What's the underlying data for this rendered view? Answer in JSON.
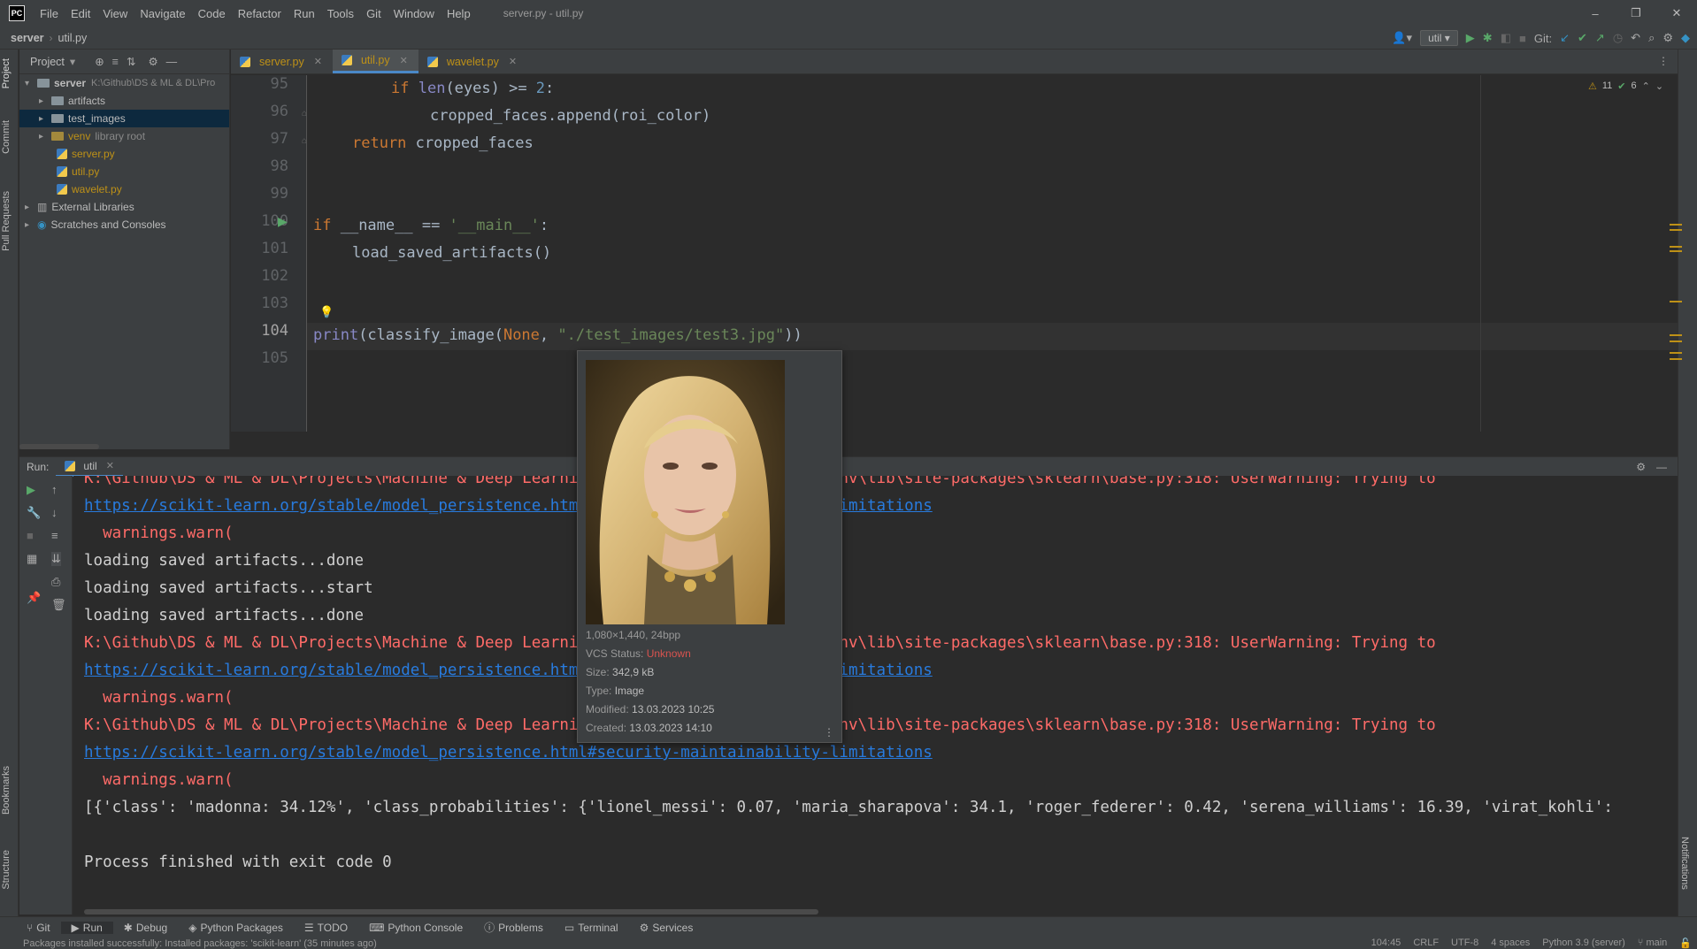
{
  "app": {
    "logo": "PC",
    "window_title": "server.py - util.py"
  },
  "menu": [
    "File",
    "Edit",
    "View",
    "Navigate",
    "Code",
    "Refactor",
    "Run",
    "Tools",
    "Git",
    "Window",
    "Help"
  ],
  "window_controls": {
    "minimize": "–",
    "restore": "❐",
    "close": "✕"
  },
  "breadcrumb": {
    "project": "server",
    "file": "util.py"
  },
  "toolbar": {
    "run_config": "util",
    "git_label": "Git:"
  },
  "left_strip": {
    "project": "Project",
    "commit": "Commit",
    "pull_requests": "Pull Requests",
    "bookmarks": "Bookmarks",
    "structure": "Structure"
  },
  "right_strip": {
    "notifications": "Notifications"
  },
  "project_panel": {
    "title": "Project",
    "root_name": "server",
    "root_path": "K:\\Github\\DS & ML & DL\\Pro",
    "items": [
      {
        "label": "artifacts",
        "kind": "folder"
      },
      {
        "label": "test_images",
        "kind": "folder"
      },
      {
        "label": "venv",
        "extra": "library root",
        "kind": "folder"
      },
      {
        "label": "server.py",
        "kind": "py"
      },
      {
        "label": "util.py",
        "kind": "py"
      },
      {
        "label": "wavelet.py",
        "kind": "py"
      }
    ],
    "external": "External Libraries",
    "scratches": "Scratches and Consoles"
  },
  "editor_tabs": [
    {
      "label": "server.py"
    },
    {
      "label": "util.py",
      "active": true
    },
    {
      "label": "wavelet.py"
    }
  ],
  "inspections": {
    "warnings": "11",
    "ok": "6"
  },
  "line_numbers": [
    "95",
    "96",
    "97",
    "98",
    "99",
    "100",
    "101",
    "102",
    "103",
    "104",
    "105"
  ],
  "code": {
    "l95_kw": "if ",
    "l95_bi": "len",
    "l95_mid": "(eyes) >= ",
    "l95_num": "2",
    "l95_end": ":",
    "l96": "cropped_faces.append(roi_color)",
    "l97_kw": "return ",
    "l97_rest": "cropped_faces",
    "l100_kw": "if ",
    "l100_mid": "__name__ == ",
    "l100_str": "'__main__'",
    "l100_end": ":",
    "l101": "load_saved_artifacts()",
    "l104_bi": "print",
    "l104_a": "(classify_image(",
    "l104_kw": "None",
    "l104_b": ", ",
    "l104_str": "\"./test_images/test3.jpg\"",
    "l104_c": "))"
  },
  "run": {
    "label": "Run:",
    "tab": "util"
  },
  "console": [
    {
      "cls": "err",
      "text": "K:\\Github\\DS & ML & DL\\Projects\\Machine & Deep Learning\\FaceRecognition\\server\\venv\\lib\\site-packages\\sklearn\\base.py:318: UserWarning: Trying to"
    },
    {
      "cls": "link",
      "text": "https://scikit-learn.org/stable/model_persistence.html#security-maintainability-limitations"
    },
    {
      "cls": "err",
      "text": "  warnings.warn("
    },
    {
      "cls": "out",
      "text": "loading saved artifacts...done"
    },
    {
      "cls": "out",
      "text": "loading saved artifacts...start"
    },
    {
      "cls": "out",
      "text": "loading saved artifacts...done"
    },
    {
      "cls": "err",
      "text": "K:\\Github\\DS & ML & DL\\Projects\\Machine & Deep Learning\\FaceRecognition\\server\\venv\\lib\\site-packages\\sklearn\\base.py:318: UserWarning: Trying to"
    },
    {
      "cls": "link",
      "text": "https://scikit-learn.org/stable/model_persistence.html#security-maintainability-limitations"
    },
    {
      "cls": "err",
      "text": "  warnings.warn("
    },
    {
      "cls": "err",
      "text": "K:\\Github\\DS & ML & DL\\Projects\\Machine & Deep Learning\\FaceRecognition\\server\\venv\\lib\\site-packages\\sklearn\\base.py:318: UserWarning: Trying to"
    },
    {
      "cls": "link",
      "text": "https://scikit-learn.org/stable/model_persistence.html#security-maintainability-limitations"
    },
    {
      "cls": "err",
      "text": "  warnings.warn("
    },
    {
      "cls": "out",
      "text": "[{'class': 'madonna: 34.12%', 'class_probabilities': {'lionel_messi': 0.07, 'maria_sharapova': 34.1, 'roger_federer': 0.42, 'serena_williams': 16.39, 'virat_kohli':"
    },
    {
      "cls": "out",
      "text": ""
    },
    {
      "cls": "out",
      "text": "Process finished with exit code 0"
    }
  ],
  "popup": {
    "dims": "1,080×1,440, 24bpp",
    "vcs_label": "VCS Status:",
    "vcs_value": "Unknown",
    "size_label": "Size:",
    "size_value": "342,9 kB",
    "type_label": "Type:",
    "type_value": "Image",
    "modified_label": "Modified:",
    "modified_value": "13.03.2023 10:25",
    "created_label": "Created:",
    "created_value": "13.03.2023 14:10"
  },
  "bottom_tabs": [
    "Git",
    "Run",
    "Debug",
    "Python Packages",
    "TODO",
    "Python Console",
    "Problems",
    "Terminal",
    "Services"
  ],
  "status": {
    "message": "Packages installed successfully: Installed packages: 'scikit-learn' (35 minutes ago)",
    "position": "104:45",
    "line_sep": "CRLF",
    "encoding": "UTF-8",
    "indent": "4 spaces",
    "interpreter": "Python 3.9 (server)",
    "branch": "main"
  }
}
